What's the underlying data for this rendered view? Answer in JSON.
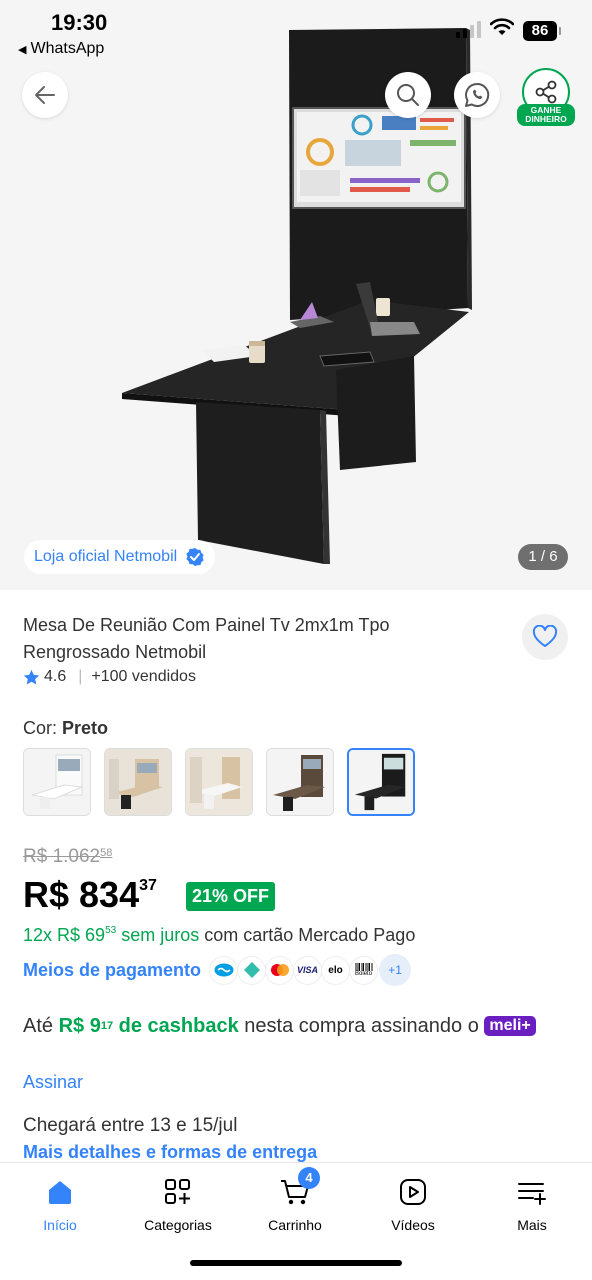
{
  "status_bar": {
    "time": "19:30",
    "back_app": "WhatsApp",
    "battery": "86"
  },
  "gallery": {
    "store_badge": "Loja oficial Netmobil",
    "counter": "1 / 6",
    "earn_label": "GANHE DINHEIRO"
  },
  "product": {
    "title": "Mesa De Reunião Com Painel Tv 2mx1m Tpo Rengrossado Netmobil",
    "rating": "4.6",
    "sold": "+100 vendidos"
  },
  "color": {
    "label": "Cor:",
    "selected": "Preto",
    "selected_index": 4
  },
  "price": {
    "old_int": "R$ 1.062",
    "old_cents": "58",
    "int": "R$ 834",
    "cents": "37",
    "discount": "21% OFF"
  },
  "installments": {
    "prefix": "12x R$ 69",
    "cents": "53",
    "suffix": " sem juros",
    "card": " com cartão Mercado Pago"
  },
  "payments": {
    "link": "Meios de pagamento",
    "visa": "VISA",
    "elo": "elo",
    "boleto": "Boleto",
    "more": "+1"
  },
  "cashback": {
    "pre": "Até ",
    "amount": "R$ 9",
    "cents": "17",
    "label": " de cashback",
    "post": " nesta compra assinando o ",
    "badge": "meli+",
    "subscribe": "Assinar"
  },
  "delivery": {
    "text": "Chegará entre 13 e 15/jul",
    "link": "Mais detalhes e formas de entrega"
  },
  "nav": {
    "home": "Início",
    "categories": "Categorias",
    "cart": "Carrinho",
    "cart_count": "4",
    "videos": "Vídeos",
    "more": "Mais"
  },
  "colors": {
    "accent": "#3483fa",
    "green": "#00a650",
    "meli_purple": "#6a1fc1"
  }
}
